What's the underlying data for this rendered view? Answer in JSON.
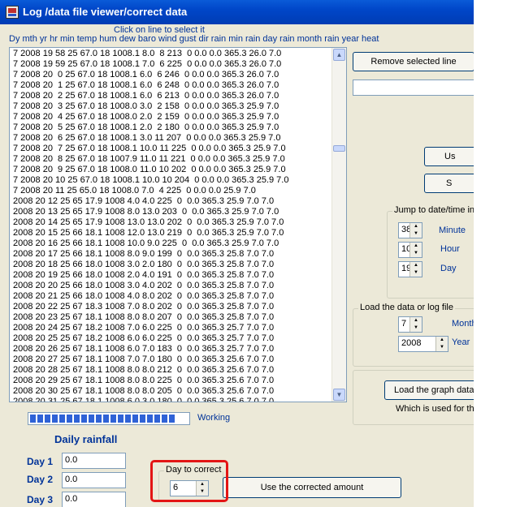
{
  "window": {
    "title": "Log /data file viewer/correct data"
  },
  "list": {
    "hint": "Click on line to select it",
    "column_header": "Dy mth yr hr min temp hum dew baro wind gust dir rain min rain day rain month rain year heat",
    "lines": [
      "7 2008 19 58 25 67.0 18 1008.1 8.0  8 213  0 0.0 0.0 365.3 26.0 7.0",
      "7 2008 19 59 25 67.0 18 1008.1 7.0  6 225  0 0.0 0.0 365.3 26.0 7.0",
      "7 2008 20  0 25 67.0 18 1008.1 6.0  6 246  0 0.0 0.0 365.3 26.0 7.0",
      "7 2008 20  1 25 67.0 18 1008.1 6.0  6 248  0 0.0 0.0 365.3 26.0 7.0",
      "7 2008 20  2 25 67.0 18 1008.1 6.0  6 213  0 0.0 0.0 365.3 26.0 7.0",
      "7 2008 20  3 25 67.0 18 1008.0 3.0  2 158  0 0.0 0.0 365.3 25.9 7.0",
      "7 2008 20  4 25 67.0 18 1008.0 2.0  2 159  0 0.0 0.0 365.3 25.9 7.0",
      "7 2008 20  5 25 67.0 18 1008.1 2.0  2 180  0 0.0 0.0 365.3 25.9 7.0",
      "7 2008 20  6 25 67.0 18 1008.1 3.0 11 207  0 0.0 0.0 365.3 25.9 7.0",
      "7 2008 20  7 25 67.0 18 1008.1 10.0 11 225  0 0.0 0.0 365.3 25.9 7.0",
      "7 2008 20  8 25 67.0 18 1007.9 11.0 11 221  0 0.0 0.0 365.3 25.9 7.0",
      "7 2008 20  9 25 67.0 18 1008.0 11.0 10 202  0 0.0 0.0 365.3 25.9 7.0",
      "7 2008 20 10 25 67.0 18 1008.1 10.0 10 204  0 0.0 0.0 365.3 25.9 7.0",
      "7 2008 20 11 25 65.0 18 1008.0 7.0  4 225  0 0.0 0.0 25.9 7.0",
      "2008 20 12 25 65 17.9 1008 4.0 4.0 225  0  0.0 365.3 25.9 7.0 7.0",
      "2008 20 13 25 65 17.9 1008 8.0 13.0 203  0  0.0 365.3 25.9 7.0 7.0",
      "2008 20 14 25 65 17.9 1008 13.0 13.0 202  0  0.0 365.3 25.9 7.0 7.0",
      "2008 20 15 25 66 18.1 1008 12.0 13.0 219  0  0.0 365.3 25.9 7.0 7.0",
      "2008 20 16 25 66 18.1 1008 10.0 9.0 225  0  0.0 365.3 25.9 7.0 7.0",
      "2008 20 17 25 66 18.1 1008 8.0 9.0 199  0  0.0 365.3 25.8 7.0 7.0",
      "2008 20 18 25 66 18.0 1008 3.0 2.0 180  0  0.0 365.3 25.8 7.0 7.0",
      "2008 20 19 25 66 18.0 1008 2.0 4.0 191  0  0.0 365.3 25.8 7.0 7.0",
      "2008 20 20 25 66 18.0 1008 3.0 4.0 202  0  0.0 365.3 25.8 7.0 7.0",
      "2008 20 21 25 66 18.0 1008 4.0 8.0 202  0  0.0 365.3 25.8 7.0 7.0",
      "2008 20 22 25 67 18.3 1008 7.0 8.0 202  0  0.0 365.3 25.8 7.0 7.0",
      "2008 20 23 25 67 18.1 1008 8.0 8.0 207  0  0.0 365.3 25.8 7.0 7.0",
      "2008 20 24 25 67 18.2 1008 7.0 6.0 225  0  0.0 365.3 25.7 7.0 7.0",
      "2008 20 25 25 67 18.2 1008 6.0 6.0 225  0  0.0 365.3 25.7 7.0 7.0",
      "2008 20 26 25 67 18.1 1008 6.0 7.0 183  0  0.0 365.3 25.7 7.0 7.0",
      "2008 20 27 25 67 18.1 1008 7.0 7.0 180  0  0.0 365.3 25.6 7.0 7.0",
      "2008 20 28 25 67 18.1 1008 8.0 8.0 212  0  0.0 365.3 25.6 7.0 7.0",
      "2008 20 29 25 67 18.1 1008 8.0 8.0 225  0  0.0 365.3 25.6 7.0 7.0",
      "2008 20 30 25 67 18.1 1008 8.0 8.0 205  0  0.0 365.3 25.6 7.0 7.0",
      "2008 20 31 25 67 18.1 1008 6.0 3.0 180  0  0.0 365.3 25.6 7.0 7.0"
    ]
  },
  "buttons": {
    "remove_selected": "Remove selected line",
    "partial_1": "Us",
    "partial_2": "S",
    "load_graph": "Load the graph data",
    "use_corrected": "Use the corrected amount"
  },
  "jump": {
    "legend": "Jump to date/time in",
    "minute_label": "Minute",
    "minute_value": "38",
    "hour_label": "Hour",
    "hour_value": "10",
    "day_label": "Day",
    "day_value": "19"
  },
  "load": {
    "legend": "Load the data or log file",
    "month_label": "Month",
    "month_value": "7",
    "year_label": "Year",
    "year_value": "2008"
  },
  "graph_note": "Which is used for the",
  "progress": {
    "label": "Working",
    "fraction": 0.93
  },
  "rainfall": {
    "title": "Daily rainfall",
    "days": [
      {
        "label": "Day 1",
        "value": "0.0"
      },
      {
        "label": "Day 2",
        "value": "0.0"
      },
      {
        "label": "Day 3",
        "value": "0.0"
      }
    ]
  },
  "correct": {
    "legend": "Day to correct",
    "value": "6"
  },
  "colors": {
    "annotation": "#e31515",
    "titlebar": "#0046c8",
    "label_blue": "#003399"
  },
  "icons": {
    "app": "app-window-icon",
    "spin_up": "spin-up-icon",
    "spin_down": "spin-down-icon"
  }
}
